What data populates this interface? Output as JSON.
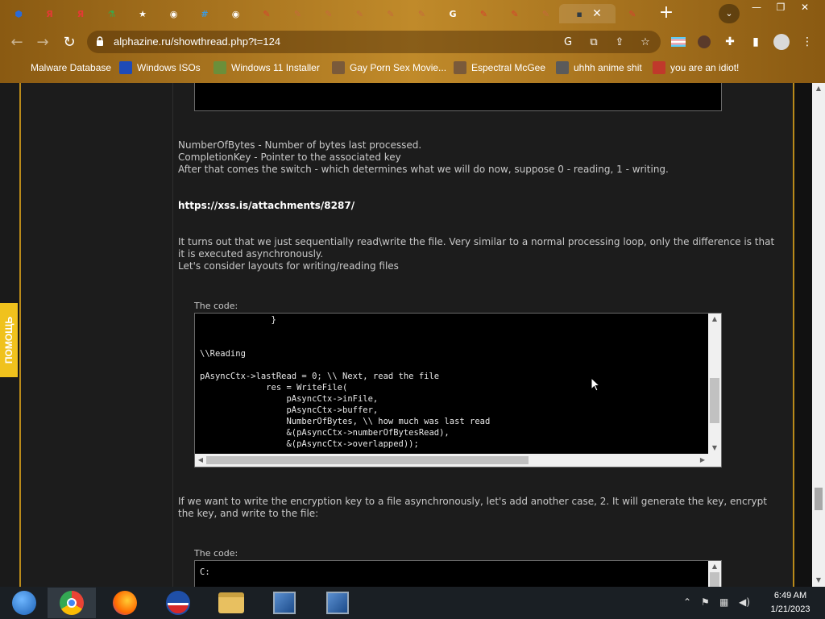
{
  "browser": {
    "url": "alphazine.ru/showthread.php?t=124",
    "tabs": [
      {
        "icon": "hex-icon",
        "color": "#2a6ad8",
        "glyph": "⬢"
      },
      {
        "icon": "yandex-icon",
        "color": "#e53935",
        "glyph": "Я"
      },
      {
        "icon": "yandex-icon",
        "color": "#e53935",
        "glyph": "Я"
      },
      {
        "icon": "flask-icon",
        "color": "#3aa84a",
        "glyph": "⚗"
      },
      {
        "icon": "star-logo-icon",
        "color": "#ffffff",
        "glyph": "★"
      },
      {
        "icon": "globe-icon",
        "color": "#ffffff",
        "glyph": "◉"
      },
      {
        "icon": "grid-icon",
        "color": "#3b9ae0",
        "glyph": "#"
      },
      {
        "icon": "globe-icon",
        "color": "#ffffff",
        "glyph": "◉"
      },
      {
        "icon": "pencil-icon",
        "color": "#d8412f",
        "glyph": "✎"
      },
      {
        "icon": "pencil-icon",
        "color": "#c66a3c",
        "glyph": "✎"
      },
      {
        "icon": "pencil-icon",
        "color": "#c66a3c",
        "glyph": "✎"
      },
      {
        "icon": "pencil-icon",
        "color": "#c66a3c",
        "glyph": "✎"
      },
      {
        "icon": "pencil-icon",
        "color": "#c66a3c",
        "glyph": "✎"
      },
      {
        "icon": "pencil-icon",
        "color": "#c66a3c",
        "glyph": "✎"
      },
      {
        "icon": "google-icon",
        "color": "#ffffff",
        "glyph": "G"
      },
      {
        "icon": "pencil-icon",
        "color": "#d8412f",
        "glyph": "✎"
      },
      {
        "icon": "pencil-icon",
        "color": "#d8412f",
        "glyph": "✎"
      },
      {
        "icon": "pencil-icon",
        "color": "#c66a3c",
        "glyph": "✎"
      },
      {
        "icon": "terminal-icon",
        "color": "#2f3b45",
        "glyph": "▪"
      }
    ],
    "active_tab_close": "✕",
    "last_tab": {
      "icon": "pencil-icon",
      "color": "#d8412f",
      "glyph": "✎"
    },
    "new_tab": "+",
    "tab_search": "⌄",
    "win_min": "—",
    "win_max": "❐",
    "win_close": "✕"
  },
  "bookmarks": [
    {
      "label": "Malware Database",
      "icon": "",
      "color": ""
    },
    {
      "label": "Windows ISOs",
      "icon": "x-logo-icon",
      "color": "#1e4bb8"
    },
    {
      "label": "Windows 11 Installer",
      "icon": "image-icon",
      "color": "#6b8f3a"
    },
    {
      "label": "Gay Porn Sex Movie...",
      "icon": "gear-bookmark-icon",
      "color": "#7a5a3a"
    },
    {
      "label": "Espectral McGee",
      "icon": "face-icon",
      "color": "#7a5a3a"
    },
    {
      "label": "uhhh anime shit",
      "icon": "anime-icon",
      "color": "#5a5a5a"
    },
    {
      "label": "you are an idiot!",
      "icon": "flag-icon",
      "color": "#c0392b"
    }
  ],
  "post": {
    "line1": "NumberOfBytes - Number of bytes last processed.",
    "line2": "CompletionKey - Pointer to the associated key",
    "line3": "After that comes the switch - which determines what we will do now, suppose 0 - reading, 1 - writing.",
    "link": "https://xss.is/attachments/8287/",
    "para1_a": "It turns out that we just sequentially read\\write the file. Very similar to a normal processing loop, only the difference is that",
    "para1_b": "it is executed asynchronously.",
    "para1_c": "Let's consider layouts for writing/reading files",
    "code_label_1": "The code:",
    "code_lines": [
      "              }",
      "",
      "",
      "\\\\Reading",
      "",
      "pAsyncCtx->lastRead = 0; \\\\ Next, read the file",
      "             res = WriteFile(",
      "                 pAsyncCtx->inFile,",
      "                 pAsyncCtx->buffer,",
      "                 NumberOfBytes, \\\\ how much was last read",
      "                 &(pAsyncCtx->numberOfBytesRead),",
      "                 &(pAsyncCtx->overlapped));"
    ],
    "para2_a": "If we want to write the encryption key to a file asynchronously, let's add another case, 2. It will generate the key, encrypt",
    "para2_b": "the key, and write to the file:",
    "code_label_2": "The code:",
    "code2_first_line": "C:"
  },
  "help_tab": "ПОМОЩЬ",
  "taskbar": {
    "apps": [
      "start-orb-icon",
      "chrome-icon",
      "firefox-icon",
      "obama-icon",
      "file-explorer-icon",
      "installer-icon",
      "installer-icon"
    ],
    "time": "6:49 AM",
    "date": "1/21/2023"
  },
  "colors": {
    "chrome_gold": "#a6721e",
    "page_bg": "#1c1c1c",
    "accent_gold": "#b98a1a",
    "help_yellow": "#f0c21d"
  }
}
